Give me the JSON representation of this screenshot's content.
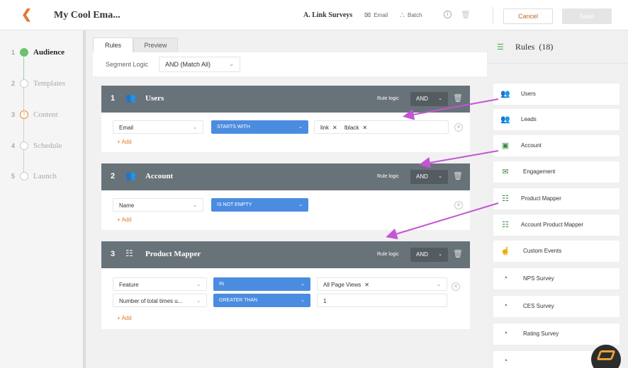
{
  "header": {
    "title": "My Cool Ema...",
    "survey_label": "A. Link Surveys",
    "email_label": "Email",
    "batch_label": "Batch",
    "info": "i",
    "cancel_label": "Cancel",
    "save_label": "Save",
    "accent_color": "#e07a2e"
  },
  "steps": [
    {
      "num": "1",
      "label": "Audience",
      "state": "active"
    },
    {
      "num": "2",
      "label": "Templates",
      "state": "idle"
    },
    {
      "num": "3",
      "label": "Content",
      "state": "warning",
      "badge": "!"
    },
    {
      "num": "4",
      "label": "Schedule",
      "state": "idle"
    },
    {
      "num": "5",
      "label": "Launch",
      "state": "idle"
    }
  ],
  "tabs": [
    {
      "label": "Rules",
      "selected": true
    },
    {
      "label": "Preview",
      "selected": false
    }
  ],
  "segment": {
    "label": "Segment Logic",
    "value": "AND (Match All)"
  },
  "rules": [
    {
      "num": "1",
      "title": "Users",
      "icon": "users-icon",
      "logic_label": "Rule logic",
      "logic": "AND",
      "rows": [
        {
          "field": "Email",
          "operator": "STARTS WITH",
          "values": [
            "link",
            "lblack"
          ]
        }
      ],
      "add_label": "+ Add"
    },
    {
      "num": "2",
      "title": "Account",
      "icon": "users-icon",
      "logic_label": "Rule logic",
      "logic": "AND",
      "rows": [
        {
          "field": "Name",
          "operator": "IS NOT EMPTY"
        }
      ],
      "add_label": "+ Add"
    },
    {
      "num": "3",
      "title": "Product Mapper",
      "icon": "product-mapper-icon",
      "logic_label": "Rule logic",
      "logic": "AND",
      "rows": [
        {
          "field": "Feature",
          "operator": "IN",
          "values": [
            "All Page Views"
          ]
        },
        {
          "field": "Number of total times u...",
          "operator": "GREATER THAN",
          "value": "1"
        }
      ],
      "add_label": "+ Add"
    }
  ],
  "rules_panel": {
    "title": "Rules",
    "count": "(18)",
    "items": [
      {
        "label": "Users",
        "icon": "users-icon"
      },
      {
        "label": "Leads",
        "icon": "users-icon"
      },
      {
        "label": "Account",
        "icon": "account-icon"
      },
      {
        "label": "Engagement",
        "icon": "envelope-icon"
      },
      {
        "label": "Product Mapper",
        "icon": "product-mapper-icon"
      },
      {
        "label": "Account Product Mapper",
        "icon": "product-mapper-icon"
      },
      {
        "label": "Custom Events",
        "icon": "hand-pointer-icon"
      },
      {
        "label": "NPS Survey",
        "icon": "survey-icon"
      },
      {
        "label": "CES Survey",
        "icon": "survey-icon"
      },
      {
        "label": "Rating Survey",
        "icon": "survey-icon"
      }
    ]
  },
  "annotation_color": "#c455d4"
}
